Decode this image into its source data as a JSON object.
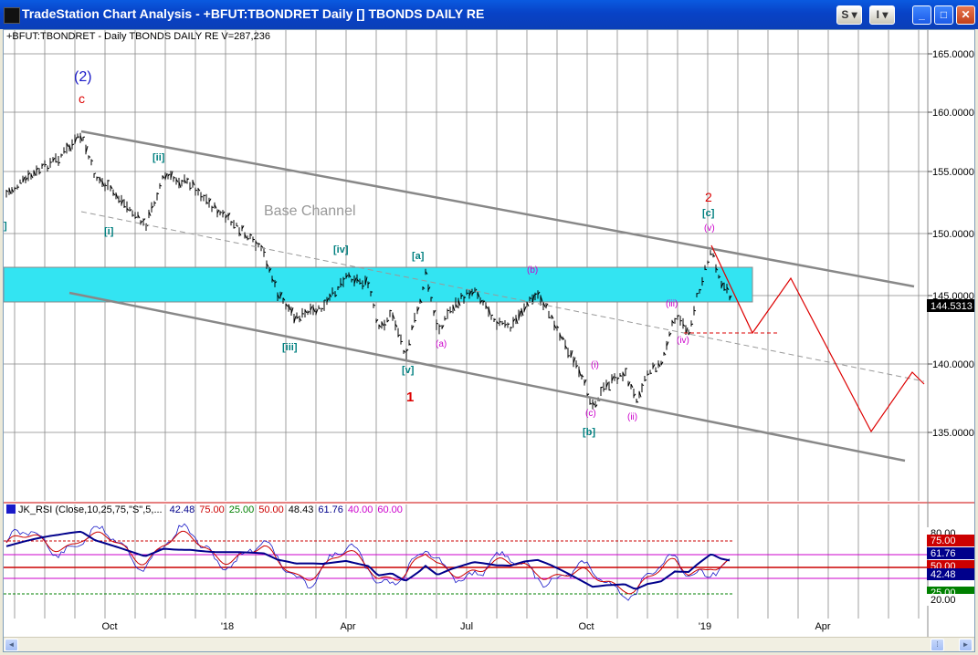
{
  "window": {
    "title": "TradeStation Chart Analysis  - +BFUT:TBONDRET Daily [] TBONDS DAILY RE",
    "btn_s": "S",
    "btn_i": "I",
    "minimize": "_",
    "maximize": "□",
    "close": "✕"
  },
  "chart": {
    "info_line": "+BFUT:TBONDRET - Daily  TBONDS DAILY RE  V=287,236",
    "channel_label": "Base Channel",
    "price_axis": [
      "165.0000",
      "160.0000",
      "155.0000",
      "150.0000",
      "145.0000",
      "140.0000",
      "135.0000"
    ],
    "last_price": "144.5313",
    "date_axis": [
      "Oct",
      "'18",
      "Apr",
      "Jul",
      "Oct",
      "'19",
      "Apr"
    ],
    "waves": {
      "w2_big": "(2)",
      "c_top": "c",
      "i": "[i]",
      "ii": "[ii]",
      "iii": "[iii]",
      "iv": "[iv]",
      "v": "[v]",
      "a": "[a]",
      "one": "1",
      "small_a": "(a)",
      "small_b": "(b)",
      "small_i": "(i)",
      "small_c": "(c)",
      "b": "[b]",
      "small_ii": "(ii)",
      "small_iii": "(iii)",
      "small_iv": "(iv)",
      "small_v": "(v)",
      "c": "[c]",
      "two": "2",
      "edge": "]"
    }
  },
  "rsi": {
    "label": "JK_RSI (Close,10,25,75,\"S\",5,...",
    "vals": [
      "42.48",
      "75.00",
      "25.00",
      "50.00",
      "48.43",
      "61.76",
      "40.00",
      "60.00"
    ],
    "colors": [
      "#00008b",
      "#cc0000",
      "#008000",
      "#cc0000",
      "#000000",
      "#00008b",
      "#cc00cc",
      "#cc00cc"
    ],
    "axis": [
      "80.00",
      "75.00",
      "61.76",
      "50.00",
      "42.48",
      "25.00",
      "20.00"
    ]
  },
  "colors": {
    "zone": "#33e4f2",
    "channel": "#888888",
    "projection": "#dd0000",
    "wave_blue": "#008080",
    "wave_magenta": "#cc00cc",
    "wave_red": "#dd0000"
  }
}
